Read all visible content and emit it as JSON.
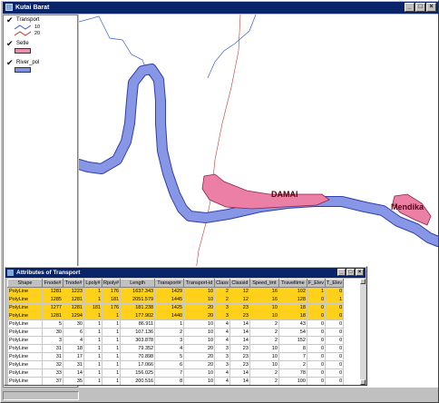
{
  "window": {
    "title": "Kutai Barat",
    "min": "_",
    "max": "□",
    "close": "×"
  },
  "toc": {
    "layers": [
      {
        "name": "Transport",
        "checked": true,
        "legend": [
          {
            "label": "10",
            "color": "#3b5bd6"
          },
          {
            "label": "20",
            "color": "#c0392b"
          }
        ]
      },
      {
        "name": "Setle",
        "checked": true,
        "fill": "#f08cac"
      },
      {
        "name": "River_pol",
        "checked": true,
        "fill": "#7f93e6"
      }
    ],
    "check_glyph": "✔"
  },
  "map": {
    "labels": [
      "DAMAI",
      "Mendika"
    ],
    "colors": {
      "river": "#8896e6",
      "river_edge": "#2f3fae",
      "settlement": "#ec7fa6",
      "road_10": "#3b5bd6",
      "road_20": "#c0392b"
    }
  },
  "attributes": {
    "title": "Attributes of Transport",
    "columns": [
      "Shape",
      "Fnode#",
      "Tnode#",
      "Lpoly#",
      "Rpoly#",
      "Length",
      "Transport#",
      "Transport-id",
      "Class",
      "Classid",
      "Speed_lmt",
      "Traveltime",
      "F_Elev",
      "T_Elev"
    ],
    "rows": [
      {
        "selected": true,
        "cells": [
          "PolyLine",
          "1281",
          "1223",
          "1",
          "176",
          "1637.343",
          "1429",
          "10",
          "2",
          "12",
          "16",
          "102",
          "1",
          "0"
        ]
      },
      {
        "selected": true,
        "cells": [
          "PolyLine",
          "1285",
          "1281",
          "1",
          "181",
          "2051.579",
          "1445",
          "10",
          "2",
          "12",
          "16",
          "128",
          "0",
          "1"
        ]
      },
      {
        "selected": true,
        "cells": [
          "PolyLine",
          "1277",
          "1281",
          "181",
          "176",
          "181.238",
          "1425",
          "20",
          "3",
          "23",
          "10",
          "18",
          "0",
          "0"
        ]
      },
      {
        "selected": true,
        "cells": [
          "PolyLine",
          "1281",
          "1294",
          "1",
          "1",
          "177.902",
          "1440",
          "20",
          "3",
          "23",
          "10",
          "18",
          "0",
          "0"
        ]
      },
      {
        "selected": false,
        "cells": [
          "PolyLine",
          "5",
          "30",
          "1",
          "1",
          "86.911",
          "1",
          "10",
          "4",
          "14",
          "2",
          "43",
          "0",
          "0"
        ]
      },
      {
        "selected": false,
        "cells": [
          "PolyLine",
          "30",
          "6",
          "1",
          "1",
          "107.136",
          "2",
          "10",
          "4",
          "14",
          "2",
          "54",
          "0",
          "0"
        ]
      },
      {
        "selected": false,
        "cells": [
          "PolyLine",
          "3",
          "4",
          "1",
          "1",
          "303.878",
          "3",
          "10",
          "4",
          "14",
          "2",
          "152",
          "0",
          "0"
        ]
      },
      {
        "selected": false,
        "cells": [
          "PolyLine",
          "31",
          "18",
          "1",
          "1",
          "79.352",
          "4",
          "20",
          "3",
          "23",
          "10",
          "8",
          "0",
          "0"
        ]
      },
      {
        "selected": false,
        "cells": [
          "PolyLine",
          "31",
          "17",
          "1",
          "1",
          "70.898",
          "5",
          "20",
          "3",
          "23",
          "10",
          "7",
          "0",
          "0"
        ]
      },
      {
        "selected": false,
        "cells": [
          "PolyLine",
          "32",
          "31",
          "1",
          "1",
          "17.066",
          "6",
          "20",
          "3",
          "23",
          "10",
          "2",
          "0",
          "0"
        ]
      },
      {
        "selected": false,
        "cells": [
          "PolyLine",
          "33",
          "14",
          "1",
          "1",
          "156.025",
          "7",
          "10",
          "4",
          "14",
          "2",
          "78",
          "0",
          "0"
        ]
      },
      {
        "selected": false,
        "cells": [
          "PolyLine",
          "37",
          "35",
          "1",
          "1",
          "200.516",
          "8",
          "10",
          "4",
          "14",
          "2",
          "100",
          "0",
          "0"
        ]
      }
    ]
  }
}
